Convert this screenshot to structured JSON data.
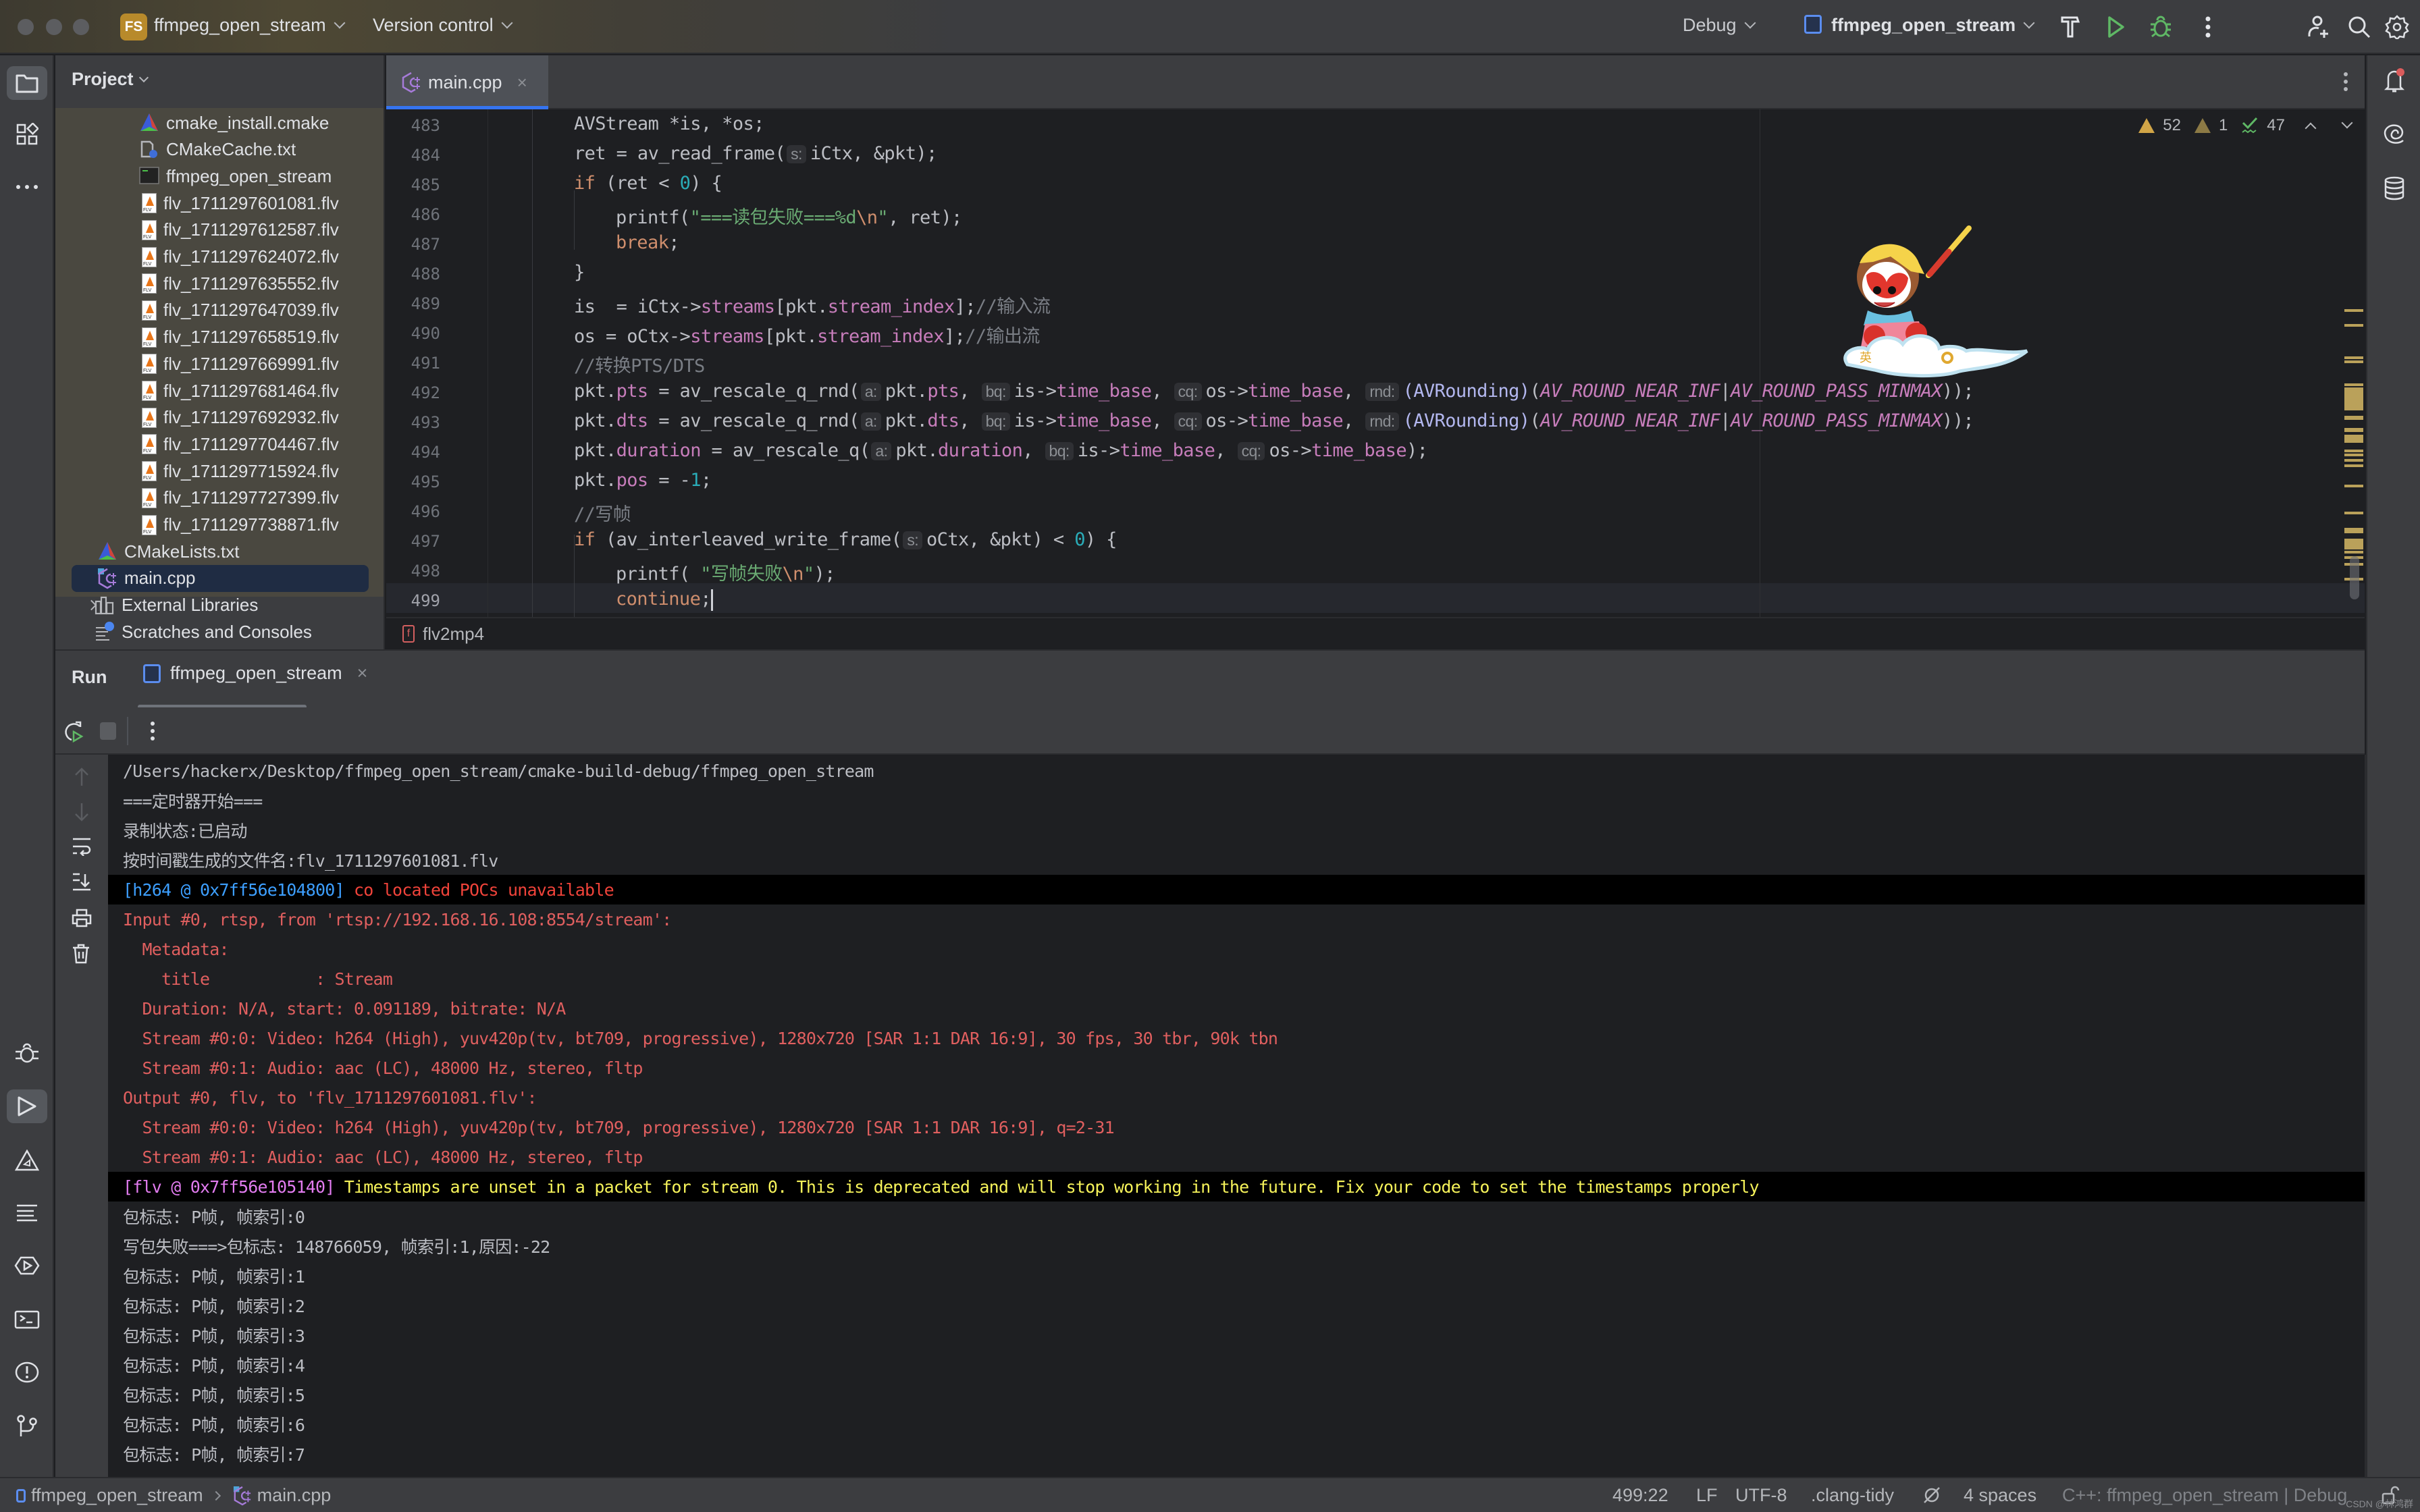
{
  "titlebar": {
    "project_badge": "FS",
    "project_name": "ffmpeg_open_stream",
    "vcs_label": "Version control",
    "build_config": "Debug",
    "run_config": "ffmpeg_open_stream",
    "icons": [
      "hammer-icon",
      "run-icon",
      "debug-icon",
      "more-icon",
      "add-user-icon",
      "search-icon",
      "settings-icon"
    ]
  },
  "left_strip": {
    "top": [
      "project-folder-icon",
      "structure-icon",
      "more-icon"
    ],
    "bottom": [
      "debug-icon",
      "run-icon",
      "cmake-icon",
      "messages-icon",
      "services-icon",
      "terminal-icon",
      "problems-icon",
      "git-icon"
    ],
    "active": "run-icon"
  },
  "right_strip": [
    "notifications-icon",
    "ai-assistant-icon",
    "database-icon"
  ],
  "project_panel": {
    "title": "Project",
    "items": [
      {
        "label": "cmake_install.cmake",
        "icon": "cmake-icon",
        "level": 2
      },
      {
        "label": "CMakeCache.txt",
        "icon": "config-file-icon",
        "level": 2
      },
      {
        "label": "ffmpeg_open_stream",
        "icon": "executable-icon",
        "level": 2
      },
      {
        "label": "flv_1711297601081.flv",
        "icon": "flv-file-icon",
        "level": 2
      },
      {
        "label": "flv_1711297612587.flv",
        "icon": "flv-file-icon",
        "level": 2
      },
      {
        "label": "flv_1711297624072.flv",
        "icon": "flv-file-icon",
        "level": 2
      },
      {
        "label": "flv_1711297635552.flv",
        "icon": "flv-file-icon",
        "level": 2
      },
      {
        "label": "flv_1711297647039.flv",
        "icon": "flv-file-icon",
        "level": 2
      },
      {
        "label": "flv_1711297658519.flv",
        "icon": "flv-file-icon",
        "level": 2
      },
      {
        "label": "flv_1711297669991.flv",
        "icon": "flv-file-icon",
        "level": 2
      },
      {
        "label": "flv_1711297681464.flv",
        "icon": "flv-file-icon",
        "level": 2
      },
      {
        "label": "flv_1711297692932.flv",
        "icon": "flv-file-icon",
        "level": 2
      },
      {
        "label": "flv_1711297704467.flv",
        "icon": "flv-file-icon",
        "level": 2
      },
      {
        "label": "flv_1711297715924.flv",
        "icon": "flv-file-icon",
        "level": 2
      },
      {
        "label": "flv_1711297727399.flv",
        "icon": "flv-file-icon",
        "level": 2
      },
      {
        "label": "flv_1711297738871.flv",
        "icon": "flv-file-icon",
        "level": 2
      },
      {
        "label": "CMakeLists.txt",
        "icon": "cmake-icon",
        "level": 1
      },
      {
        "label": "main.cpp",
        "icon": "cpp-file-icon",
        "level": 1,
        "selected": true
      },
      {
        "label": "External Libraries",
        "icon": "library-icon",
        "level": 0,
        "expandable": true
      },
      {
        "label": "Scratches and Consoles",
        "icon": "scratches-icon",
        "level": 0
      }
    ]
  },
  "editor": {
    "tab": {
      "label": "main.cpp",
      "close": "×"
    },
    "inspections": {
      "warnings": "52",
      "weak_warnings": "1",
      "typos": "47"
    },
    "lines": [
      {
        "n": "483",
        "indent": 0,
        "html": "AVStream *is, *os;"
      },
      {
        "n": "484",
        "indent": 0,
        "html": "ret = av_read_frame(<span class=\"hint\">s:</span>iCtx, &amp;pkt);"
      },
      {
        "n": "485",
        "indent": 0,
        "html": "<span class=\"kw\">if</span> (ret &lt; <span class=\"num\">0</span>) {"
      },
      {
        "n": "486",
        "indent": 1,
        "html": "printf(<span class=\"str\">\"===读包失败===%d</span><span class=\"kw\">\\n</span><span class=\"str\">\"</span>, ret);"
      },
      {
        "n": "487",
        "indent": 1,
        "html": "<span class=\"kw\">break</span>;"
      },
      {
        "n": "488",
        "indent": 0,
        "html": "}"
      },
      {
        "n": "489",
        "indent": 0,
        "html": "is  = iCtx-&gt;<span class=\"fld\">streams</span>[pkt.<span class=\"fld\">stream_index</span>];<span class=\"cmt\">//输入流</span>"
      },
      {
        "n": "490",
        "indent": 0,
        "html": "os = oCtx-&gt;<span class=\"fld\">streams</span>[pkt.<span class=\"fld\">stream_index</span>];<span class=\"cmt\">//输出流</span>"
      },
      {
        "n": "491",
        "indent": 0,
        "html": "<span class=\"cmt\">//转换PTS/DTS</span>"
      },
      {
        "n": "492",
        "indent": 0,
        "html": "pkt.<span class=\"fld\">pts</span> = av_rescale_q_rnd(<span class=\"hint\">a:</span>pkt.<span class=\"fld\">pts</span>, <span class=\"hint\">bq:</span>is-&gt;<span class=\"fld\">time_base</span>, <span class=\"hint\">cq:</span>os-&gt;<span class=\"fld\">time_base</span>, <span class=\"hint\">rnd:</span><span class=\"typ\">(AVRounding)</span>(<span class=\"mac\">AV_ROUND_NEAR_INF</span>|<span class=\"mac\">AV_ROUND_PASS_MINMAX</span>));"
      },
      {
        "n": "493",
        "indent": 0,
        "html": "pkt.<span class=\"fld\">dts</span> = av_rescale_q_rnd(<span class=\"hint\">a:</span>pkt.<span class=\"fld\">dts</span>, <span class=\"hint\">bq:</span>is-&gt;<span class=\"fld\">time_base</span>, <span class=\"hint\">cq:</span>os-&gt;<span class=\"fld\">time_base</span>, <span class=\"hint\">rnd:</span><span class=\"typ\">(AVRounding)</span>(<span class=\"mac\">AV_ROUND_NEAR_INF</span>|<span class=\"mac\">AV_ROUND_PASS_MINMAX</span>));"
      },
      {
        "n": "494",
        "indent": 0,
        "html": "pkt.<span class=\"fld\">duration</span> = av_rescale_q(<span class=\"hint\">a:</span>pkt.<span class=\"fld\">duration</span>, <span class=\"hint\">bq:</span>is-&gt;<span class=\"fld\">time_base</span>, <span class=\"hint\">cq:</span>os-&gt;<span class=\"fld\">time_base</span>);"
      },
      {
        "n": "495",
        "indent": 0,
        "html": "pkt.<span class=\"fld\">pos</span> = -<span class=\"num\">1</span>;"
      },
      {
        "n": "496",
        "indent": 0,
        "html": "<span class=\"cmt\">//写帧</span>"
      },
      {
        "n": "497",
        "indent": 0,
        "html": "<span class=\"kw\">if</span> (av_interleaved_write_frame(<span class=\"hint\">s:</span>oCtx, &amp;pkt) &lt; <span class=\"num\">0</span>) {"
      },
      {
        "n": "498",
        "indent": 1,
        "html": "printf( <span class=\"str\">\"写帧失败</span><span class=\"kw\">\\n</span><span class=\"str\">\"</span>);"
      },
      {
        "n": "499",
        "indent": 1,
        "html": "<span class=\"kw\">continue</span>;<span id=\"caret\"></span>",
        "current": true
      }
    ],
    "breadcrumb_function": "flv2mp4"
  },
  "run_panel": {
    "title": "Run",
    "tab_label": "ffmpeg_open_stream",
    "tab_close": "×",
    "console": [
      {
        "style": "plain",
        "segments": [
          {
            "c": "",
            "t": "/Users/hackerx/Desktop/ffmpeg_open_stream/cmake-build-debug/ffmpeg_open_stream"
          }
        ]
      },
      {
        "style": "plain",
        "segments": [
          {
            "c": "",
            "t": "===定时器开始==="
          }
        ]
      },
      {
        "style": "plain",
        "segments": [
          {
            "c": "",
            "t": "录制状态:已启动"
          }
        ]
      },
      {
        "style": "plain",
        "segments": [
          {
            "c": "",
            "t": "按时间戳生成的文件名:flv_1711297601081.flv"
          }
        ]
      },
      {
        "style": "black",
        "segments": [
          {
            "c": "c-blue",
            "t": "[h264 @ 0x7ff56e104800] "
          },
          {
            "c": "c-brred",
            "t": "co located POCs unavailable"
          }
        ]
      },
      {
        "style": "plain",
        "segments": [
          {
            "c": "c-red",
            "t": "Input #0, rtsp, from 'rtsp://192.168.16.108:8554/stream':"
          }
        ]
      },
      {
        "style": "plain",
        "segments": [
          {
            "c": "c-red",
            "t": "  Metadata:"
          }
        ]
      },
      {
        "style": "plain",
        "segments": [
          {
            "c": "c-red",
            "t": "    title           : Stream"
          }
        ]
      },
      {
        "style": "plain",
        "segments": [
          {
            "c": "c-red",
            "t": "  Duration: N/A, start: 0.091189, bitrate: N/A"
          }
        ]
      },
      {
        "style": "plain",
        "segments": [
          {
            "c": "c-red",
            "t": "  Stream #0:0: Video: h264 (High), yuv420p(tv, bt709, progressive), 1280x720 [SAR 1:1 DAR 16:9], 30 fps, 30 tbr, 90k tbn"
          }
        ]
      },
      {
        "style": "plain",
        "segments": [
          {
            "c": "c-red",
            "t": "  Stream #0:1: Audio: aac (LC), 48000 Hz, stereo, fltp"
          }
        ]
      },
      {
        "style": "plain",
        "segments": [
          {
            "c": "c-red",
            "t": "Output #0, flv, to 'flv_1711297601081.flv':"
          }
        ]
      },
      {
        "style": "plain",
        "segments": [
          {
            "c": "c-red",
            "t": "  Stream #0:0: Video: h264 (High), yuv420p(tv, bt709, progressive), 1280x720 [SAR 1:1 DAR 16:9], q=2-31"
          }
        ]
      },
      {
        "style": "plain",
        "segments": [
          {
            "c": "c-red",
            "t": "  Stream #0:1: Audio: aac (LC), 48000 Hz, stereo, fltp"
          }
        ]
      },
      {
        "style": "black",
        "segments": [
          {
            "c": "c-mag",
            "t": "[flv @ 0x7ff56e105140] "
          },
          {
            "c": "c-yel",
            "t": "Timestamps are unset in a packet for stream 0. This is deprecated and will stop working in the future. Fix your code to set the timestamps properly"
          }
        ]
      },
      {
        "style": "plain",
        "segments": [
          {
            "c": "",
            "t": "包标志: P帧, 帧索引:0"
          }
        ]
      },
      {
        "style": "plain",
        "segments": [
          {
            "c": "",
            "t": "写包失败===>包标志: 148766059, 帧索引:1,原因:-22"
          }
        ]
      },
      {
        "style": "plain",
        "segments": [
          {
            "c": "",
            "t": "包标志: P帧, 帧索引:1"
          }
        ]
      },
      {
        "style": "plain",
        "segments": [
          {
            "c": "",
            "t": "包标志: P帧, 帧索引:2"
          }
        ]
      },
      {
        "style": "plain",
        "segments": [
          {
            "c": "",
            "t": "包标志: P帧, 帧索引:3"
          }
        ]
      },
      {
        "style": "plain",
        "segments": [
          {
            "c": "",
            "t": "包标志: P帧, 帧索引:4"
          }
        ]
      },
      {
        "style": "plain",
        "segments": [
          {
            "c": "",
            "t": "包标志: P帧, 帧索引:5"
          }
        ]
      },
      {
        "style": "plain",
        "segments": [
          {
            "c": "",
            "t": "包标志: P帧, 帧索引:6"
          }
        ]
      },
      {
        "style": "plain",
        "segments": [
          {
            "c": "",
            "t": "包标志: P帧, 帧索引:7"
          }
        ]
      }
    ]
  },
  "statusbar": {
    "crumb_project": "ffmpeg_open_stream",
    "crumb_file": "main.cpp",
    "position": "499:22",
    "line_sep": "LF",
    "encoding": "UTF-8",
    "code_style": ".clang-tidy",
    "indent": "4 spaces",
    "context": "C++: ffmpeg_open_stream | Debug",
    "watermark": "CSDN @林鸿群"
  },
  "colors": {
    "accent": "#3574f0",
    "warning": "#d1a547",
    "run_green": "#5fb865",
    "error_red": "#e05f5f"
  }
}
